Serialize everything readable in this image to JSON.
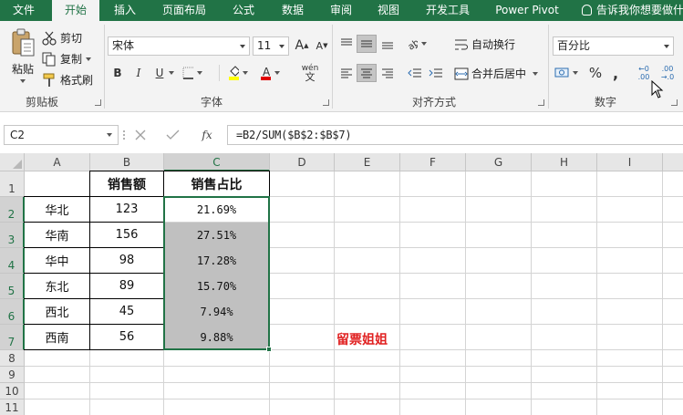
{
  "ribbon_tabs": [
    "文件",
    "开始",
    "插入",
    "页面布局",
    "公式",
    "数据",
    "审阅",
    "视图",
    "开发工具",
    "Power Pivot"
  ],
  "active_tab": "开始",
  "tell_me": "告诉我你想要做什",
  "clipboard": {
    "paste": "粘贴",
    "cut": "剪切",
    "copy": "复制",
    "format_painter": "格式刷",
    "label": "剪贴板"
  },
  "font": {
    "name": "宋体",
    "size": "11",
    "grow": "A",
    "shrink": "A",
    "bold": "B",
    "italic": "I",
    "underline": "U",
    "phonetic": "wén",
    "label": "字体"
  },
  "alignment": {
    "wrap": "自动换行",
    "merge": "合并后居中",
    "label": "对齐方式"
  },
  "number": {
    "format": "百分比",
    "percent": "%",
    "comma": ",",
    "inc_decimal": "←0 .00",
    "dec_decimal": ".00 →.0",
    "label": "数字"
  },
  "formula_bar": {
    "name_box": "C2",
    "fx": "fx",
    "formula": "=B2/SUM($B$2:$B$7)"
  },
  "columns": [
    "A",
    "B",
    "C",
    "D",
    "E",
    "F",
    "G",
    "H",
    "I"
  ],
  "selected_column": "C",
  "rows": [
    "1",
    "2",
    "3",
    "4",
    "5",
    "6",
    "7",
    "8",
    "9",
    "10",
    "11"
  ],
  "table": {
    "headers": [
      "",
      "销售额",
      "销售占比"
    ],
    "data": [
      [
        "华北",
        "123",
        "21.69%"
      ],
      [
        "华南",
        "156",
        "27.51%"
      ],
      [
        "华中",
        "98",
        "17.28%"
      ],
      [
        "东北",
        "89",
        "15.70%"
      ],
      [
        "西北",
        "45",
        "7.94%"
      ],
      [
        "西南",
        "56",
        "9.88%"
      ]
    ]
  },
  "watermark": "留票姐姐",
  "colors": {
    "excel_green": "#217346",
    "shaded_cell": "#c0c0c0",
    "watermark_red": "#e02020"
  }
}
